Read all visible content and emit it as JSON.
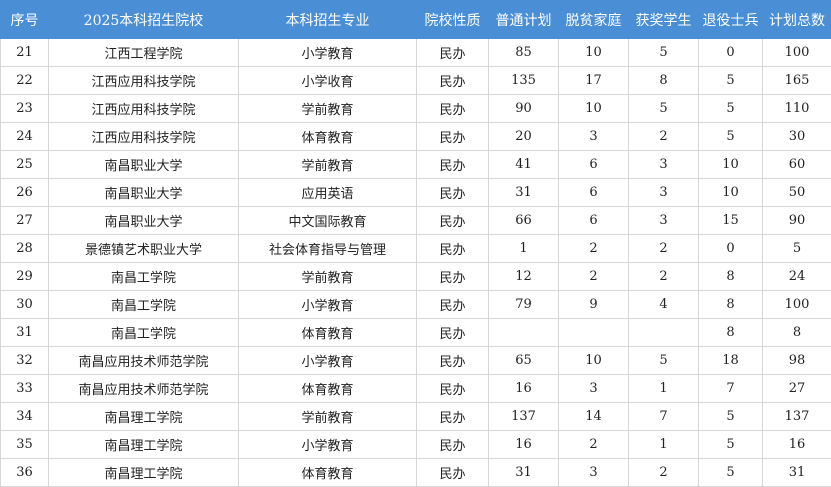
{
  "headers": [
    "序号",
    "2025本科招生院校",
    "本科招生专业",
    "院校性质",
    "普通计划",
    "脱贫家庭",
    "获奖学生",
    "退役士兵",
    "计划总数"
  ],
  "rows": [
    [
      "21",
      "江西工程学院",
      "小学教育",
      "民办",
      "85",
      "10",
      "5",
      "0",
      "100"
    ],
    [
      "22",
      "江西应用科技学院",
      "小学收育",
      "民办",
      "135",
      "17",
      "8",
      "5",
      "165"
    ],
    [
      "23",
      "江西应用科技学院",
      "学前教育",
      "民办",
      "90",
      "10",
      "5",
      "5",
      "110"
    ],
    [
      "24",
      "江西应用科技学院",
      "体育教育",
      "民办",
      "20",
      "3",
      "2",
      "5",
      "30"
    ],
    [
      "25",
      "南昌职业大学",
      "学前教育",
      "民办",
      "41",
      "6",
      "3",
      "10",
      "60"
    ],
    [
      "26",
      "南昌职业大学",
      "应用英语",
      "民办",
      "31",
      "6",
      "3",
      "10",
      "50"
    ],
    [
      "27",
      "南昌职业大学",
      "中文国际教育",
      "民办",
      "66",
      "6",
      "3",
      "15",
      "90"
    ],
    [
      "28",
      "景德镇艺术职业大学",
      "社会体育指导与管理",
      "民办",
      "1",
      "2",
      "2",
      "0",
      "5"
    ],
    [
      "29",
      "南昌工学院",
      "学前教育",
      "民办",
      "12",
      "2",
      "2",
      "8",
      "24"
    ],
    [
      "30",
      "南昌工学院",
      "小学教育",
      "民办",
      "79",
      "9",
      "4",
      "8",
      "100"
    ],
    [
      "31",
      "南昌工学院",
      "体育教育",
      "民办",
      "",
      "",
      "",
      "8",
      "8"
    ],
    [
      "32",
      "南昌应用技术师范学院",
      "小学教育",
      "民办",
      "65",
      "10",
      "5",
      "18",
      "98"
    ],
    [
      "33",
      "南昌应用技术师范学院",
      "体育教育",
      "民办",
      "16",
      "3",
      "1",
      "7",
      "27"
    ],
    [
      "34",
      "南昌理工学院",
      "学前教育",
      "民办",
      "137",
      "14",
      "7",
      "5",
      "137"
    ],
    [
      "35",
      "南昌理工学院",
      "小学教育",
      "民办",
      "16",
      "2",
      "1",
      "5",
      "16"
    ],
    [
      "36",
      "南昌理工学院",
      "体育教育",
      "民办",
      "31",
      "3",
      "2",
      "5",
      "31"
    ]
  ]
}
